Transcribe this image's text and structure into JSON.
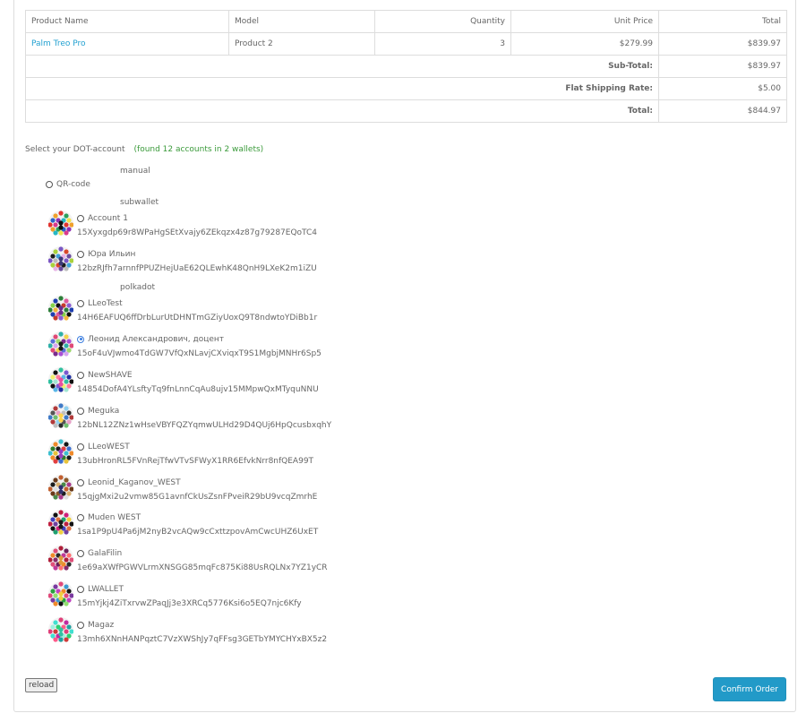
{
  "cart": {
    "headers": [
      "Product Name",
      "Model",
      "Quantity",
      "Unit Price",
      "Total"
    ],
    "items": [
      {
        "name": "Palm Treo Pro",
        "model": "Product 2",
        "quantity": "3",
        "unit_price": "$279.99",
        "total": "$839.97"
      }
    ],
    "totals": [
      {
        "label": "Sub-Total:",
        "value": "$839.97"
      },
      {
        "label": "Flat Shipping Rate:",
        "value": "$5.00"
      },
      {
        "label": "Total:",
        "value": "$844.97"
      }
    ]
  },
  "dot": {
    "select_label": "Select your DOT-account",
    "found_text": "(found 12 accounts in 2 wallets)",
    "group_manual": "manual",
    "qr_label": "QR-code",
    "group_subwallet": "subwallet",
    "group_polkadot": "polkadot",
    "accounts": [
      {
        "name": "Account 1",
        "address": "15Xyxgdp69r8WPaHgSEtXvajy6ZEkqzx4z87g79287EQoTC4",
        "selected": false
      },
      {
        "name": "Юра Ильин",
        "address": "12bzRJfh7arnnfPPUZHejUaE62QLEwhK48QnH9LXeK2m1iZU",
        "selected": false
      },
      {
        "name": "LLeoTest",
        "address": "14H6EAFUQ6ffDrbLurUtDHNTmGZiyUoxQ9T8ndwtoYDiBb1r",
        "selected": false
      },
      {
        "name": "Леонид Александрович, доцент",
        "address": "15oF4uVJwmo4TdGW7VfQxNLavjCXviqxT9S1MgbjMNHr6Sp5",
        "selected": true
      },
      {
        "name": "NewSHAVE",
        "address": "14854DofA4YLsftyTq9fnLnnCqAu8ujv15MMpwQxMTyquNNU",
        "selected": false
      },
      {
        "name": "Meguka",
        "address": "12bNL12ZNz1wHseVBYFQZYqmwULHd29D4QUj6HpQcusbxqhY",
        "selected": false
      },
      {
        "name": "LLeoWEST",
        "address": "13ubHronRL5FVnRejTfwVTvSFWyX1RR6EfvkNrr8nfQEA99T",
        "selected": false
      },
      {
        "name": "Leonid_Kaganov_WEST",
        "address": "15qjgMxi2u2vmw85G1avnfCkUsZsnFPveiR29bU9vcqZmrhE",
        "selected": false
      },
      {
        "name": "Muden WEST",
        "address": "1sa1P9pU4Pa6jM2nyB2vcAQw9cCxttzpovAmCwcUHZ6UxET",
        "selected": false
      },
      {
        "name": "GalaFilin",
        "address": "1e69aXWfPGWVLrmXNSGG85mqFc875Ki88UsRQLNx7YZ1yCR",
        "selected": false
      },
      {
        "name": "LWALLET",
        "address": "15mYjkj4ZiTxrvwZPaqJj3e3XRCq5776Ksi6o5EQ7njc6Kfy",
        "selected": false
      },
      {
        "name": "Magaz",
        "address": "13mh6XNnHANPqztC7VzXWShJy7qFFsg3GETbYMYCHYxBX5z2",
        "selected": false
      }
    ]
  },
  "actions": {
    "reload_label": "reload",
    "confirm_label": "Confirm Order"
  },
  "colors": {
    "link": "#23a1d1",
    "found_text": "#3a9a3a",
    "confirm_button": "#229ac8",
    "radio_selected": "#3d7fe0"
  }
}
